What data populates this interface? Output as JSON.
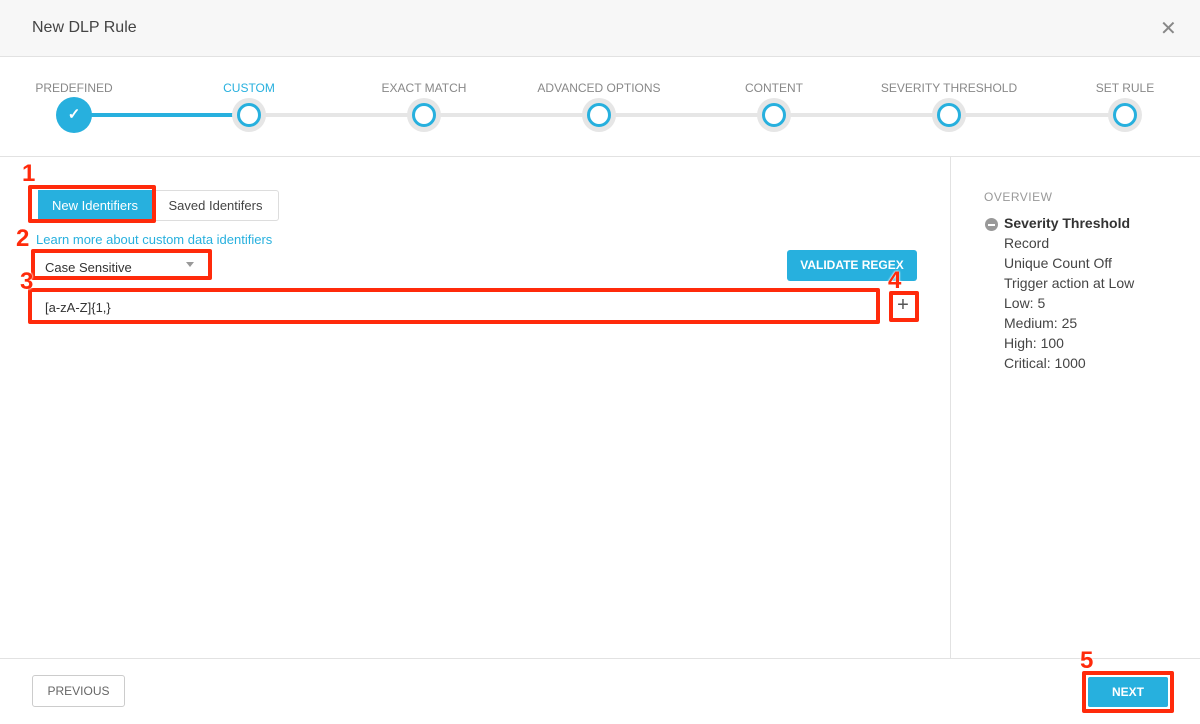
{
  "header": {
    "title": "New DLP Rule",
    "close_icon": "close-icon"
  },
  "steps": [
    {
      "label": "PREDEFINED",
      "state": "done"
    },
    {
      "label": "CUSTOM",
      "state": "active"
    },
    {
      "label": "EXACT MATCH",
      "state": "pending"
    },
    {
      "label": "ADVANCED OPTIONS",
      "state": "pending"
    },
    {
      "label": "CONTENT",
      "state": "pending"
    },
    {
      "label": "SEVERITY THRESHOLD",
      "state": "pending"
    },
    {
      "label": "SET RULE",
      "state": "pending"
    }
  ],
  "main": {
    "tabs": [
      {
        "label": "New Identifiers",
        "selected": true
      },
      {
        "label": "Saved Identifers",
        "selected": false
      }
    ],
    "learn_link": "Learn more about custom data identifiers",
    "case_select": "Case Sensitive",
    "validate_label": "VALIDATE REGEX",
    "regex_value": "[a-zA-Z]{1,}"
  },
  "overview": {
    "title": "OVERVIEW",
    "heading": "Severity Threshold",
    "lines": [
      "Record",
      "Unique Count Off",
      "Trigger action at Low",
      "Low: 5",
      "Medium: 25",
      "High: 100",
      "Critical: 1000"
    ]
  },
  "footer": {
    "previous_label": "PREVIOUS",
    "next_label": "NEXT"
  },
  "annotations": [
    "1",
    "2",
    "3",
    "4",
    "5"
  ],
  "colors": {
    "accent": "#27b0de",
    "annotation": "#ff2a0b"
  }
}
